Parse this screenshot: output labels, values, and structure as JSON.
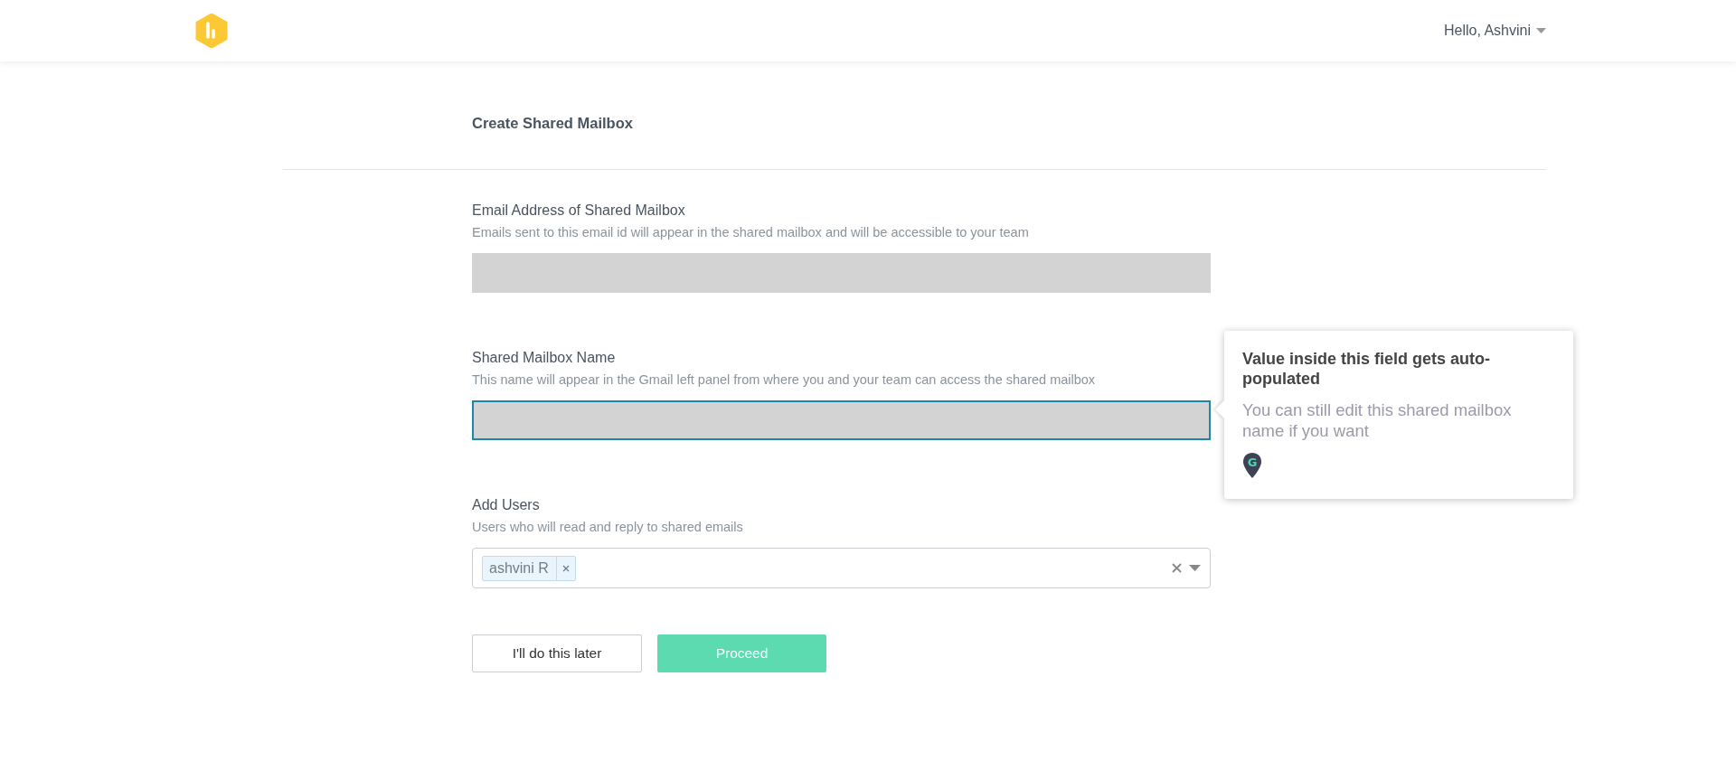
{
  "header": {
    "greeting": "Hello, Ashvini"
  },
  "page": {
    "title": "Create Shared Mailbox"
  },
  "fields": [
    {
      "kind": "text",
      "label": "Email Address of Shared Mailbox",
      "help": "Emails sent to this email id will appear in the shared mailbox and will be accessible to your team",
      "focused": false
    },
    {
      "kind": "text",
      "label": "Shared Mailbox Name",
      "help": "This name will appear in the Gmail left panel from where you and your team can access the shared mailbox",
      "focused": true
    },
    {
      "kind": "multiselect",
      "label": "Add Users",
      "help": "Users who will read and reply to shared emails",
      "tags": [
        "ashvini R"
      ]
    }
  ],
  "buttons": [
    {
      "kind": "secondary",
      "label": "I'll do this later"
    },
    {
      "kind": "primary",
      "label": "Proceed"
    }
  ],
  "tooltip": {
    "title": "Value inside this field gets auto-populated",
    "body": "You can still edit this shared mailbox name if you want",
    "badge_letter": "G"
  }
}
